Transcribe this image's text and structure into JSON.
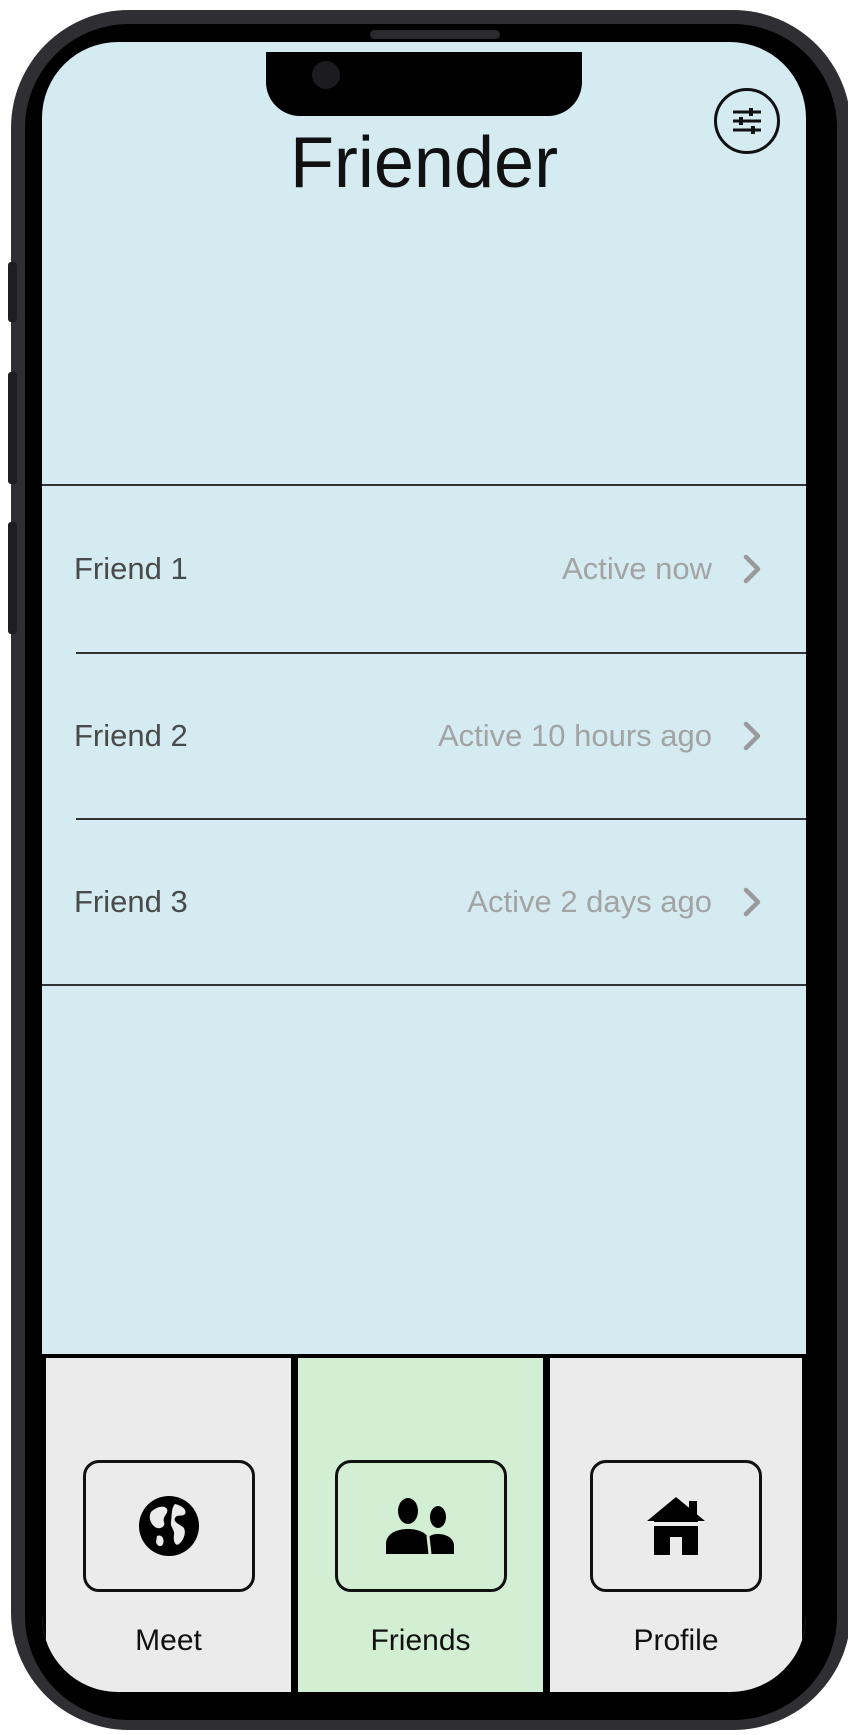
{
  "app": {
    "title": "Friender"
  },
  "header": {
    "filter_icon": "sliders-icon"
  },
  "friends": [
    {
      "name": "Friend 1",
      "status": "Active now"
    },
    {
      "name": "Friend 2",
      "status": "Active 10 hours ago"
    },
    {
      "name": "Friend 3",
      "status": "Active 2 days ago"
    }
  ],
  "tabs": [
    {
      "label": "Meet",
      "icon": "globe-icon",
      "active": false
    },
    {
      "label": "Friends",
      "icon": "friends-icon",
      "active": true
    },
    {
      "label": "Profile",
      "icon": "home-icon",
      "active": false
    }
  ],
  "colors": {
    "screen_bg": "#d5ebf2",
    "tab_bg": "#ebebeb",
    "tab_active_bg": "#d3efd3",
    "status_text": "#a3a3a3"
  }
}
